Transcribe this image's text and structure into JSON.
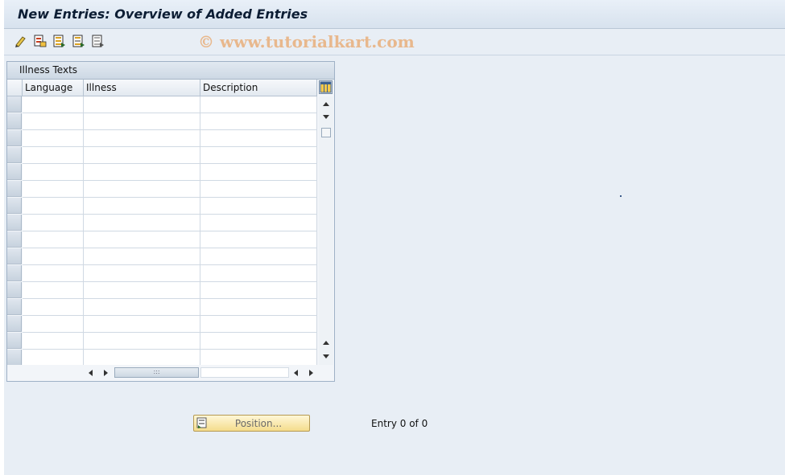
{
  "window": {
    "title": "New Entries: Overview of Added Entries"
  },
  "toolbar": {
    "icons": [
      "change-icon",
      "copy-icon",
      "select-all-icon",
      "select-block-icon",
      "deselect-all-icon"
    ]
  },
  "watermark": "© www.tutorialkart.com",
  "table": {
    "title": "Illness Texts",
    "columns": [
      "Language",
      "Illness",
      "Description"
    ],
    "row_count": 16,
    "rows": []
  },
  "footer": {
    "position_button": "Position...",
    "entry_info": "Entry 0 of 0"
  },
  "colors": {
    "background": "#e8eef5",
    "title_text": "#0c1d34",
    "button_fill": "#f4dc8c"
  }
}
